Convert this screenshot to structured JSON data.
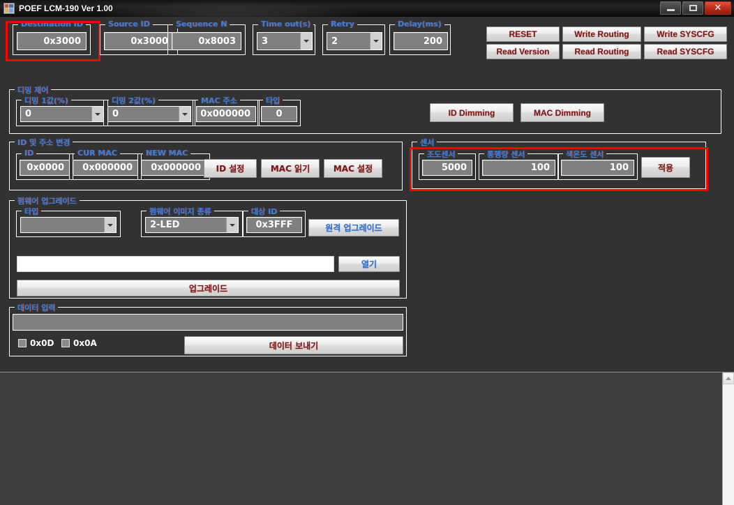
{
  "window": {
    "title": "POEF LCM-190 Ver 1.00",
    "icon": "app-icon",
    "minimize": "minimize-icon",
    "maximize": "maximize-icon",
    "close": "✕"
  },
  "header": {
    "fields": [
      {
        "label": "Destination ID",
        "value": "0x3000",
        "type": "text",
        "highlighted": true
      },
      {
        "label": "Source ID",
        "value": "0x3000",
        "type": "text",
        "highlighted": false
      },
      {
        "label": "Sequence N",
        "value": "0x8003",
        "type": "text",
        "highlighted": false
      },
      {
        "label": "Time out(s)",
        "value": "3",
        "type": "combo",
        "highlighted": false
      },
      {
        "label": "Retry",
        "value": "2",
        "type": "combo",
        "highlighted": false
      },
      {
        "label": "Delay(ms)",
        "value": "200",
        "type": "text",
        "highlighted": false
      }
    ],
    "buttons": [
      "RESET",
      "Write Routing",
      "Write SYSCFG",
      "Read Version",
      "Read Routing",
      "Read SYSCFG"
    ]
  },
  "dimming": {
    "group_label": "디밍 제어",
    "fields": [
      {
        "label": "디밍 1값(%)",
        "value": "0",
        "type": "combo"
      },
      {
        "label": "디밍 2값(%)",
        "value": "0",
        "type": "combo"
      },
      {
        "label": "MAC 주소",
        "value": "0x000000",
        "type": "text"
      },
      {
        "label": "타입",
        "value": "0",
        "type": "text"
      }
    ],
    "buttons": [
      "ID Dimming",
      "MAC Dimming"
    ]
  },
  "id_address": {
    "group_label": "ID 및 주소 변경",
    "fields": [
      {
        "label": "ID",
        "value": "0x0000"
      },
      {
        "label": "CUR MAC",
        "value": "0x000000"
      },
      {
        "label": "NEW MAC",
        "value": "0x000000"
      }
    ],
    "buttons": [
      "ID 설정",
      "MAC 읽기",
      "MAC 설정"
    ]
  },
  "sensor": {
    "group_label": "센서",
    "highlighted": true,
    "fields": [
      {
        "label": "조도센서",
        "value": "5000"
      },
      {
        "label": "통행량 센서",
        "value": "100"
      },
      {
        "label": "색온도 센서",
        "value": "100"
      }
    ],
    "apply_button": "적용"
  },
  "firmware": {
    "group_label": "펌웨어 업그레이드",
    "type_label": "타입",
    "type_value": "",
    "image_label": "펌웨어 이미지 종류",
    "image_value": "2-LED",
    "target_label": "대상 ID",
    "target_value": "0x3FFF",
    "remote_button": "원격 업그레이드",
    "path_value": "",
    "open_button": "열기",
    "upgrade_button": "업그레이드"
  },
  "data_input": {
    "group_label": "데이터 입력",
    "value": "",
    "checkbox_cr": "0x0D",
    "checkbox_lf": "0x0A",
    "checkbox_cr_checked": false,
    "checkbox_lf_checked": false,
    "send_button": "데이터 보내기"
  },
  "log_panel": {
    "content": "",
    "scrollbar_up": "scroll-up-icon"
  },
  "colors": {
    "background": "#323232",
    "group_label": "#3f7fd4",
    "field_bg": "#808080",
    "field_border": "#ffffff",
    "button_text": "#7a1616",
    "button_text_blue": "#2f6fd0",
    "highlight": "#ff0000",
    "log_panel_bg": "#3f3f3f"
  }
}
